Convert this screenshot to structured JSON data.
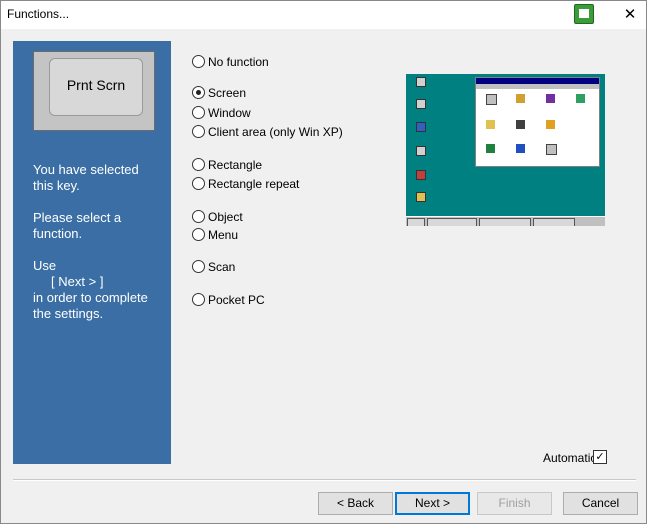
{
  "window": {
    "title": "Functions...",
    "app_icon": "green-capture-icon",
    "close_glyph": "✕"
  },
  "sidebar": {
    "key_label": "Prnt Scrn",
    "text_selected": "You have selected\nthis key.",
    "text_select_function": "Please select a\nfunction.",
    "text_use": "Use\n     [ Next > ]\nin order to complete\nthe settings.",
    "bg_color": "#3a6ea5"
  },
  "options": [
    {
      "label": "No function",
      "selected": false
    },
    {
      "label": "Screen",
      "selected": true
    },
    {
      "label": "Window",
      "selected": false
    },
    {
      "label": "Client area (only Win XP)",
      "selected": false
    },
    {
      "label": "Rectangle",
      "selected": false
    },
    {
      "label": "Rectangle repeat",
      "selected": false
    },
    {
      "label": "Object",
      "selected": false
    },
    {
      "label": "Menu",
      "selected": false
    },
    {
      "label": "Scan",
      "selected": false
    },
    {
      "label": "Pocket PC",
      "selected": false
    }
  ],
  "automatic": {
    "label": "Automatic",
    "checked": true,
    "check_glyph": "✓"
  },
  "buttons": {
    "back": "< Back",
    "next": "Next >",
    "finish": "Finish",
    "cancel": "Cancel"
  },
  "preview": {
    "desktop_color": "#008080"
  }
}
